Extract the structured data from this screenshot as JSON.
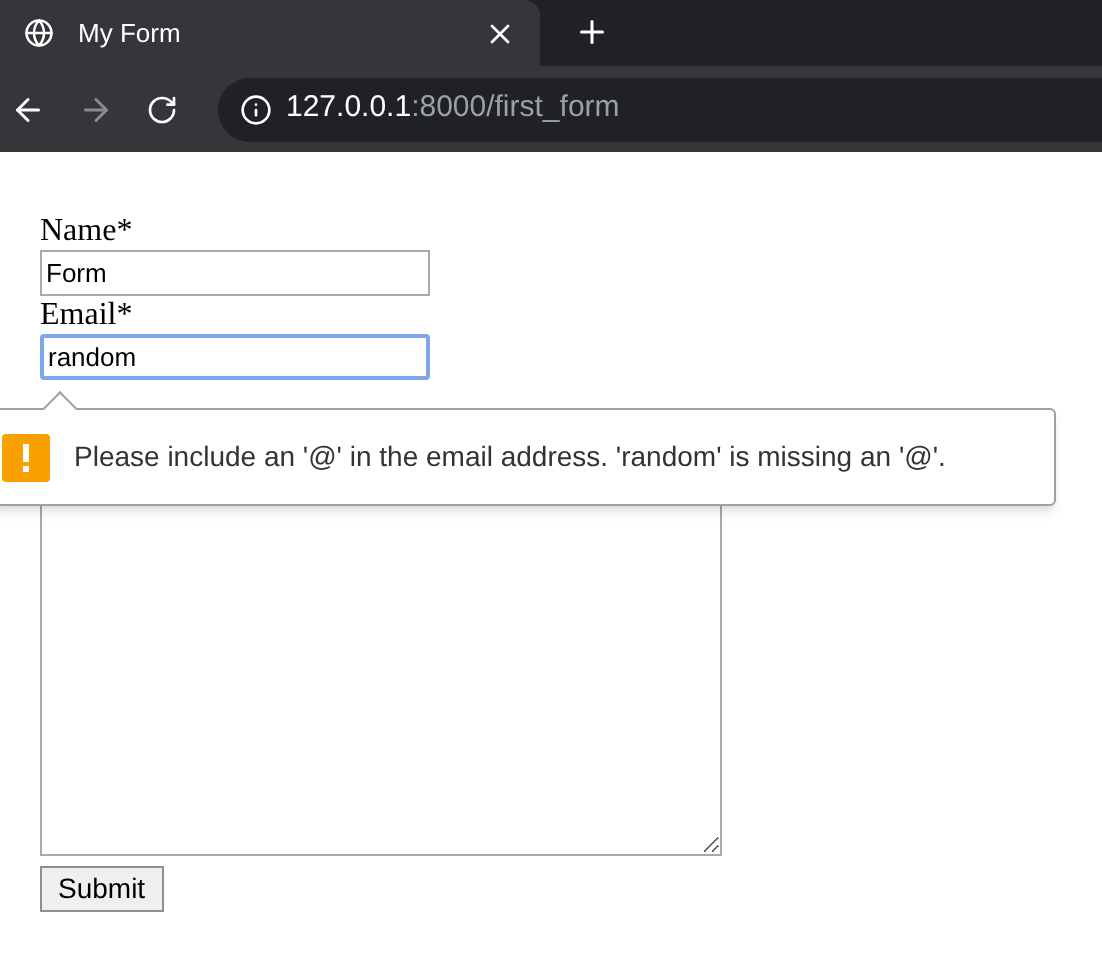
{
  "tab": {
    "title": "My Form",
    "selected": true
  },
  "address_bar": {
    "host": "127.0.0.1",
    "path": ":8000/first_form"
  },
  "form": {
    "fields": [
      {
        "kind": "input",
        "label": "Name*",
        "value": "Form",
        "focused": false
      },
      {
        "kind": "input",
        "label": "Email*",
        "value": "random",
        "focused": true
      }
    ],
    "message": {
      "kind": "textarea"
    },
    "submit": "Submit"
  },
  "validation_tooltip": {
    "text": "Please include an '@' in the email address. 'random' is missing an '@'."
  }
}
